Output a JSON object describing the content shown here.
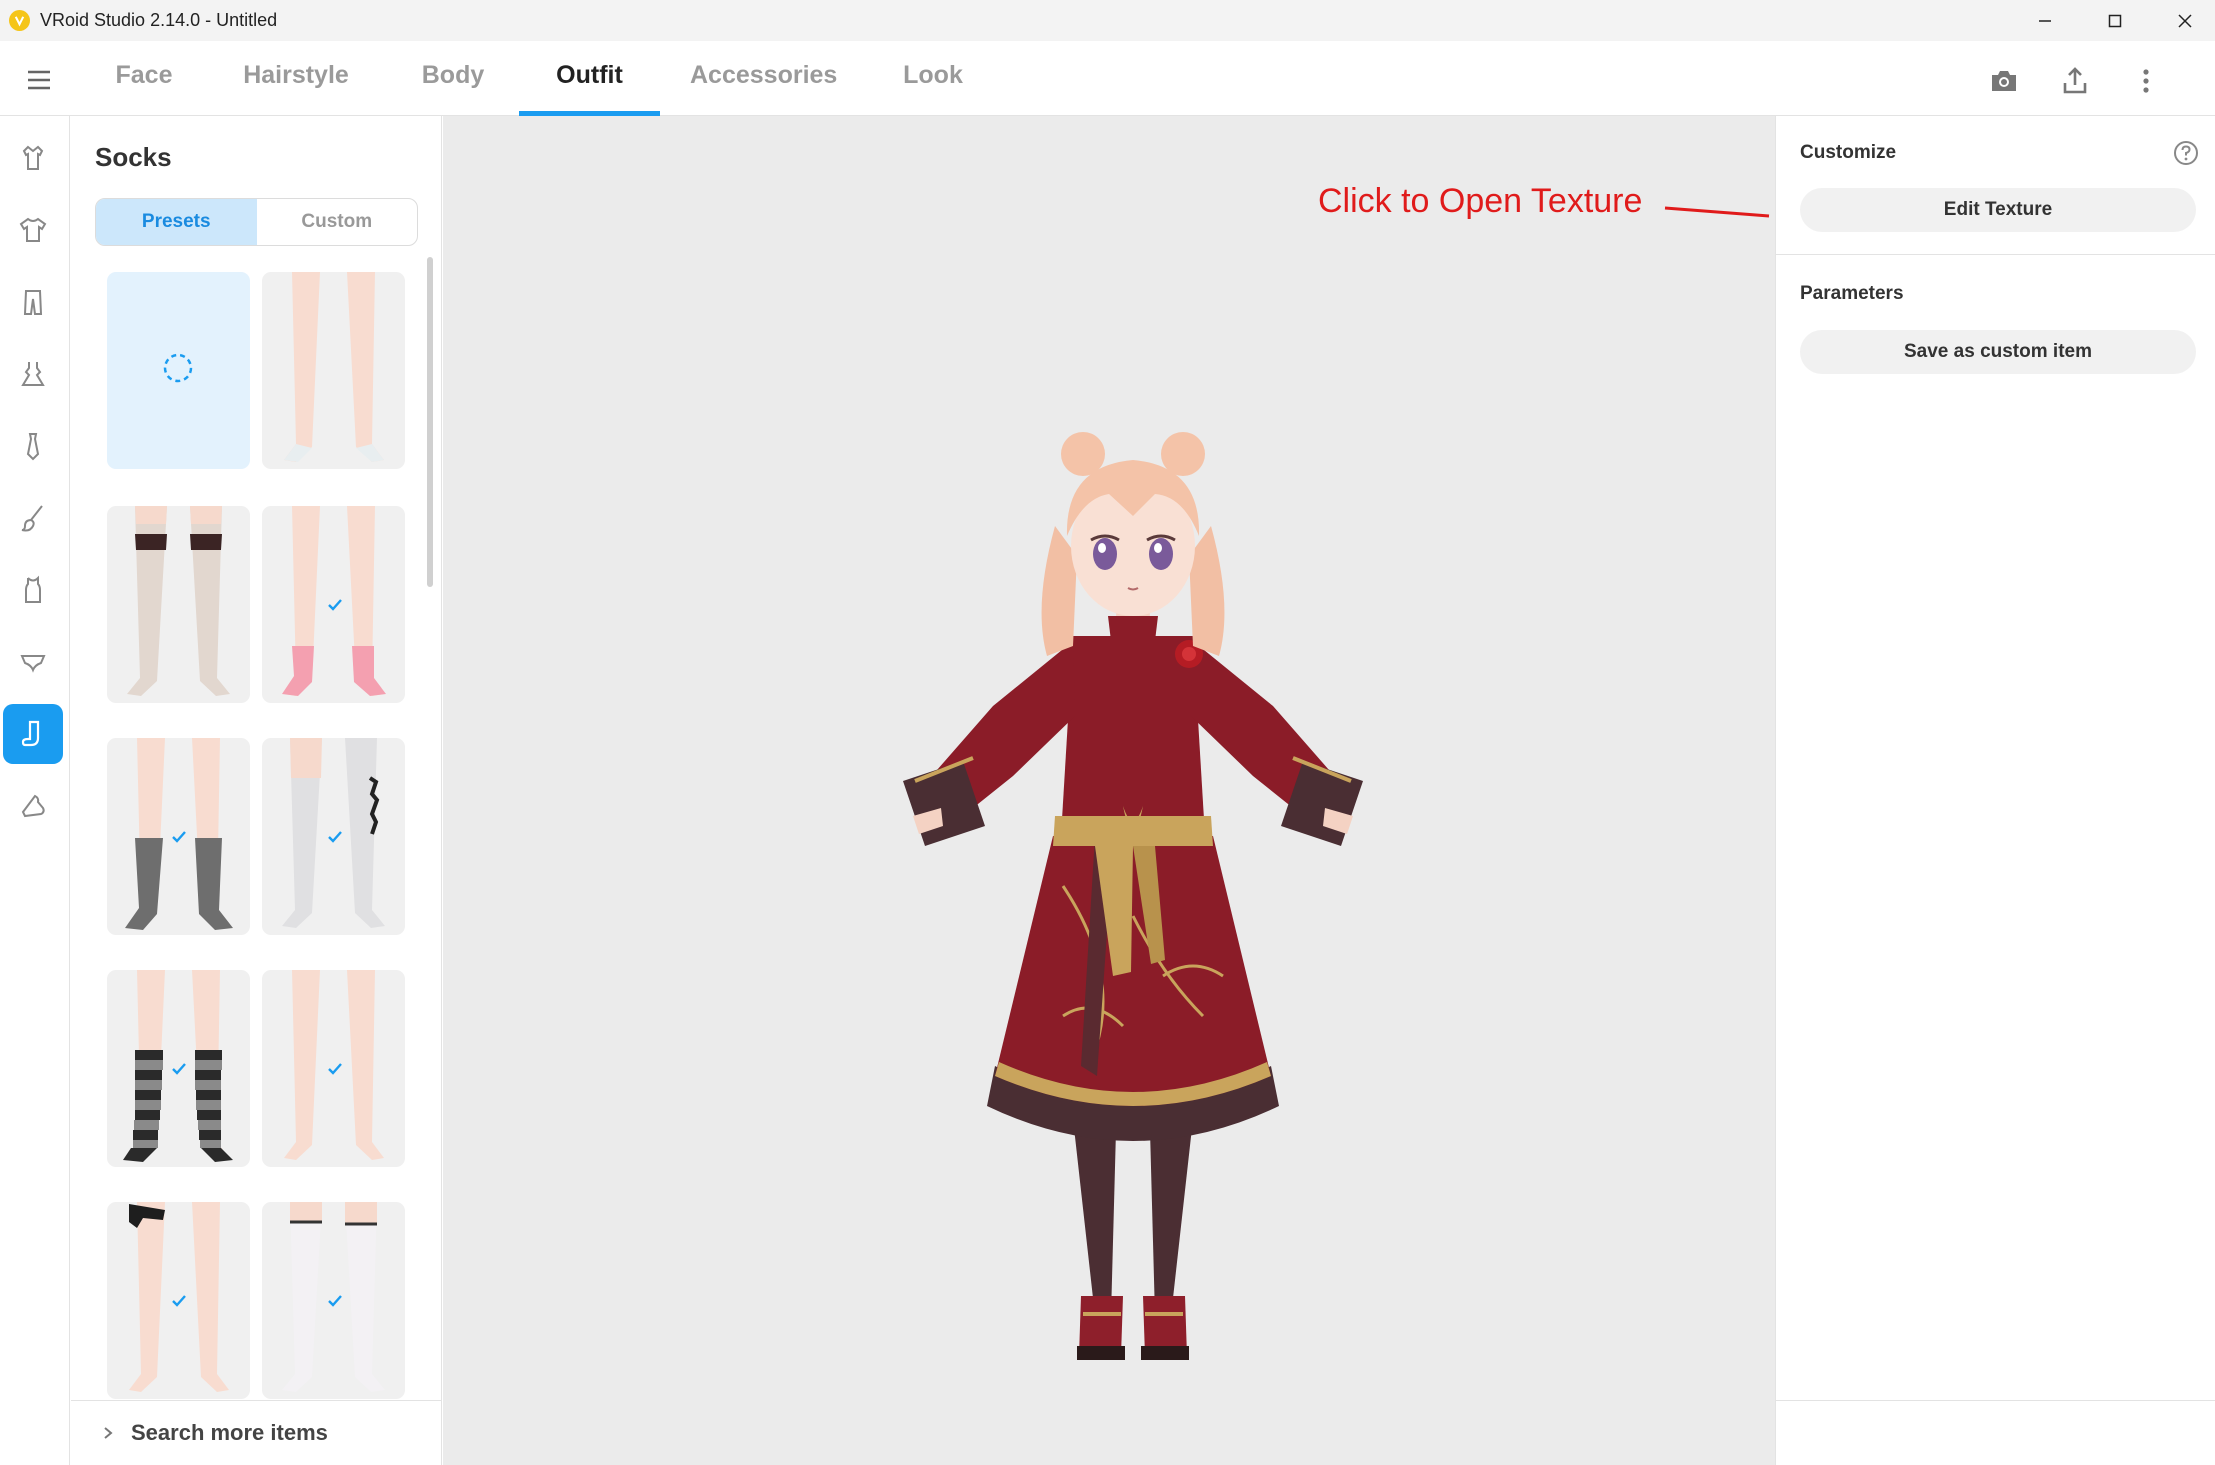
{
  "window": {
    "title": "VRoid Studio 2.14.0 - Untitled",
    "controls": [
      "minimize-icon",
      "maximize-icon",
      "close-icon"
    ]
  },
  "topnav": {
    "tabs": [
      {
        "label": "Face"
      },
      {
        "label": "Hairstyle"
      },
      {
        "label": "Body"
      },
      {
        "label": "Outfit",
        "active": true
      },
      {
        "label": "Accessories"
      },
      {
        "label": "Look"
      }
    ],
    "right_icons": [
      "camera-icon",
      "export-icon",
      "more-vertical-icon"
    ]
  },
  "rail": {
    "items": [
      {
        "icon": "outfit-set-icon"
      },
      {
        "icon": "tops-icon"
      },
      {
        "icon": "bottoms-icon"
      },
      {
        "icon": "onepiece-icon"
      },
      {
        "icon": "tie-icon"
      },
      {
        "icon": "bodypaint-icon"
      },
      {
        "icon": "inner-top-icon"
      },
      {
        "icon": "underwear-icon"
      },
      {
        "icon": "socks-icon",
        "active": true
      },
      {
        "icon": "shoes-icon"
      }
    ]
  },
  "itempanel": {
    "title": "Socks",
    "segments": {
      "presets": "Presets",
      "custom": "Custom",
      "active": "presets"
    },
    "items": [
      {
        "kind": "loading",
        "selected": true,
        "check": false
      },
      {
        "kind": "bare-ankle",
        "check": true
      },
      {
        "kind": "lace-thighhigh",
        "check": true
      },
      {
        "kind": "pink-ankle",
        "check": true
      },
      {
        "kind": "gray-knee",
        "check": true
      },
      {
        "kind": "white-thighhigh",
        "check": true
      },
      {
        "kind": "striped-knee",
        "check": true
      },
      {
        "kind": "bare",
        "check": true
      },
      {
        "kind": "garter",
        "check": false
      },
      {
        "kind": "white-stocking",
        "check": false
      }
    ],
    "search_more": "Search more items"
  },
  "viewport": {
    "annotation": "Click to Open Texture",
    "annotation_color": "#e01b1b"
  },
  "rightpanel": {
    "customize_title": "Customize",
    "edit_texture": "Edit Texture",
    "parameters_title": "Parameters",
    "save_custom": "Save as custom item"
  },
  "colors": {
    "accent": "#1a9cf0",
    "segment_active_bg": "#cce7fb",
    "dress": "#8b1c28",
    "gold": "#c9a45c"
  }
}
